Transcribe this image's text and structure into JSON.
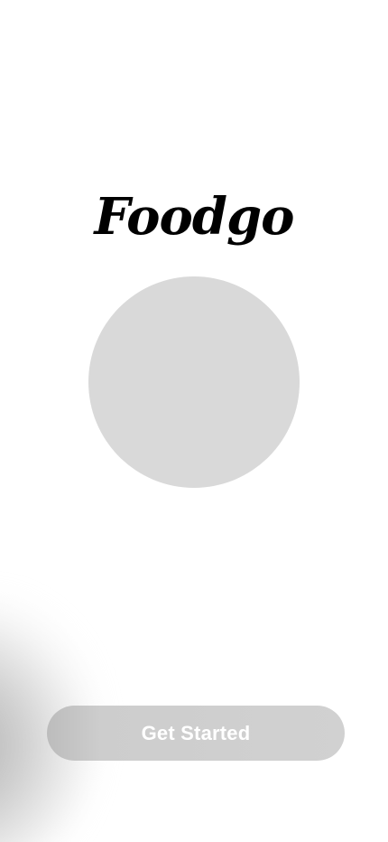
{
  "app": {
    "title": "Foodgo"
  },
  "hero": {
    "image_placeholder_color": "#d9d9d9"
  },
  "actions": {
    "get_started_label": "Get Started"
  },
  "colors": {
    "background": "#ffffff",
    "title": "#000000",
    "button_bg": "#d1d1d1",
    "button_text": "#ffffff"
  }
}
